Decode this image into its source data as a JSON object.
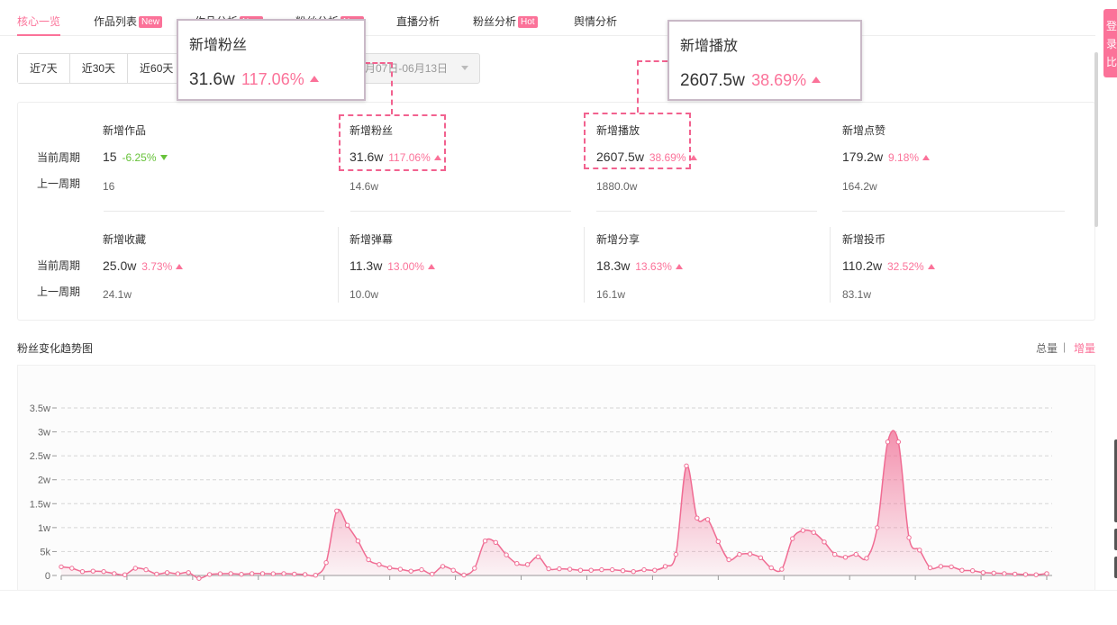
{
  "nav": {
    "tabs": [
      {
        "label": "核心一览",
        "badge": ""
      },
      {
        "label": "作品列表",
        "badge": "New"
      },
      {
        "label": "作品分析",
        "badge": "New"
      },
      {
        "label": "粉丝分析",
        "badge": "New"
      },
      {
        "label": "直播分析",
        "badge": ""
      },
      {
        "label": "粉丝分析",
        "badge": "Hot"
      },
      {
        "label": "舆情分析",
        "badge": ""
      }
    ]
  },
  "range": {
    "buttons": [
      "近7天",
      "近30天",
      "近60天"
    ],
    "date_text": "月07日-06月13日"
  },
  "stats": {
    "row_labels": {
      "current": "当前周期",
      "previous": "上一周期"
    },
    "cells": [
      {
        "title": "新增作品",
        "current": "15",
        "pct": "-6.25%",
        "direction": "down",
        "previous": "16"
      },
      {
        "title": "新增粉丝",
        "current": "31.6w",
        "pct": "117.06%",
        "direction": "up",
        "previous": "14.6w"
      },
      {
        "title": "新增播放",
        "current": "2607.5w",
        "pct": "38.69%",
        "direction": "up",
        "previous": "1880.0w"
      },
      {
        "title": "新增点赞",
        "current": "179.2w",
        "pct": "9.18%",
        "direction": "up",
        "previous": "164.2w"
      },
      {
        "title": "新增收藏",
        "current": "25.0w",
        "pct": "3.73%",
        "direction": "up",
        "previous": "24.1w"
      },
      {
        "title": "新增弹幕",
        "current": "11.3w",
        "pct": "13.00%",
        "direction": "up",
        "previous": "10.0w"
      },
      {
        "title": "新增分享",
        "current": "18.3w",
        "pct": "13.63%",
        "direction": "up",
        "previous": "16.1w"
      },
      {
        "title": "新增投币",
        "current": "110.2w",
        "pct": "32.52%",
        "direction": "up",
        "previous": "83.1w"
      }
    ]
  },
  "popups": [
    {
      "title": "新增粉丝",
      "value": "31.6w",
      "pct": "117.06%"
    },
    {
      "title": "新增播放",
      "value": "2607.5w",
      "pct": "38.69%"
    }
  ],
  "trend": {
    "title": "粉丝变化趋势图",
    "toggle_total": "总量",
    "toggle_sep": "|",
    "toggle_increment": "增量"
  },
  "side_tab_text": [
    "登",
    "录",
    "比"
  ],
  "colors": {
    "accent": "#fb7299",
    "up": "#fb7299",
    "down": "#67c23a",
    "line": "#f06c93",
    "highlight": "#f2628f"
  },
  "chart_data": {
    "type": "area",
    "title": "",
    "xlabel": "",
    "ylabel": "",
    "y_ticks": [
      "0",
      "5k",
      "1w",
      "1.5w",
      "2w",
      "2.5w",
      "3w",
      "3.5w"
    ],
    "y_tick_values": [
      0,
      5000,
      10000,
      15000,
      20000,
      25000,
      30000,
      35000
    ],
    "ylim": [
      0,
      35000
    ],
    "grid": true,
    "series": [
      {
        "values": [
          1800,
          1500,
          800,
          900,
          800,
          400,
          150,
          1500,
          1200,
          300,
          600,
          350,
          600,
          -600,
          200,
          350,
          400,
          250,
          400,
          400,
          350,
          400,
          300,
          200,
          50,
          2700,
          13500,
          10500,
          7200,
          3300,
          2300,
          1600,
          1300,
          900,
          1200,
          300,
          1900,
          1100,
          100,
          1500,
          7200,
          6900,
          4300,
          2500,
          2300,
          3900,
          1400,
          1400,
          1300,
          1100,
          1100,
          1200,
          1200,
          1000,
          800,
          1200,
          1100,
          1900,
          4400,
          22900,
          12000,
          11700,
          7100,
          3300,
          4400,
          4500,
          3700,
          1600,
          1300,
          7700,
          9400,
          9000,
          7000,
          4400,
          3800,
          4400,
          3600,
          10000,
          27900,
          27900,
          7900,
          5300,
          1600,
          1900,
          1800,
          1100,
          1000,
          600,
          500,
          400,
          300,
          200,
          150,
          400
        ]
      }
    ]
  }
}
